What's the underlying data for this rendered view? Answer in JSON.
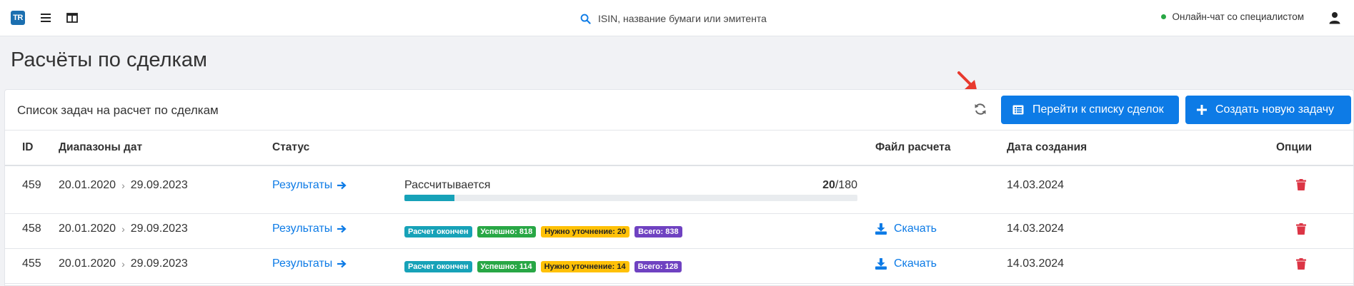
{
  "topbar": {
    "logo": "TR",
    "search_placeholder": "ISIN, название бумаги или эмитента",
    "online_chat": "Онлайн-чат со специалистом"
  },
  "page": {
    "title": "Расчёты по сделкам"
  },
  "card": {
    "title": "Список задач на расчет по сделкам",
    "btn_deals": "Перейти к списку сделок",
    "btn_create": "Создать новую задачу"
  },
  "table": {
    "headers": {
      "id": "ID",
      "ranges": "Диапазоны дат",
      "status": "Статус",
      "file": "Файл расчета",
      "created": "Дата создания",
      "options": "Опции"
    },
    "rows": [
      {
        "id": "459",
        "date_from": "20.01.2020",
        "date_to": "29.09.2023",
        "results": "Результаты",
        "progress_label": "Рассчитывается",
        "progress_done": "20",
        "progress_total": "/180",
        "progress_fraction": 0.111,
        "created": "14.03.2024"
      },
      {
        "id": "458",
        "date_from": "20.01.2020",
        "date_to": "29.09.2023",
        "results": "Результаты",
        "badges": [
          "Расчет окончен",
          "Успешно: 818",
          "Нужно уточнение: 20",
          "Всего: 838"
        ],
        "download": "Скачать",
        "created": "14.03.2024"
      },
      {
        "id": "455",
        "date_from": "20.01.2020",
        "date_to": "29.09.2023",
        "results": "Результаты",
        "badges": [
          "Расчет окончен",
          "Успешно: 114",
          "Нужно уточнение: 14",
          "Всего: 128"
        ],
        "download": "Скачать",
        "created": "14.03.2024"
      }
    ]
  },
  "colors": {
    "primary": "#0d7be6",
    "teal": "#17a2b8",
    "success": "#28a745",
    "warning": "#ffc107",
    "purple": "#6f42c1",
    "danger": "#dc3545",
    "annotation": "#e8392e"
  }
}
